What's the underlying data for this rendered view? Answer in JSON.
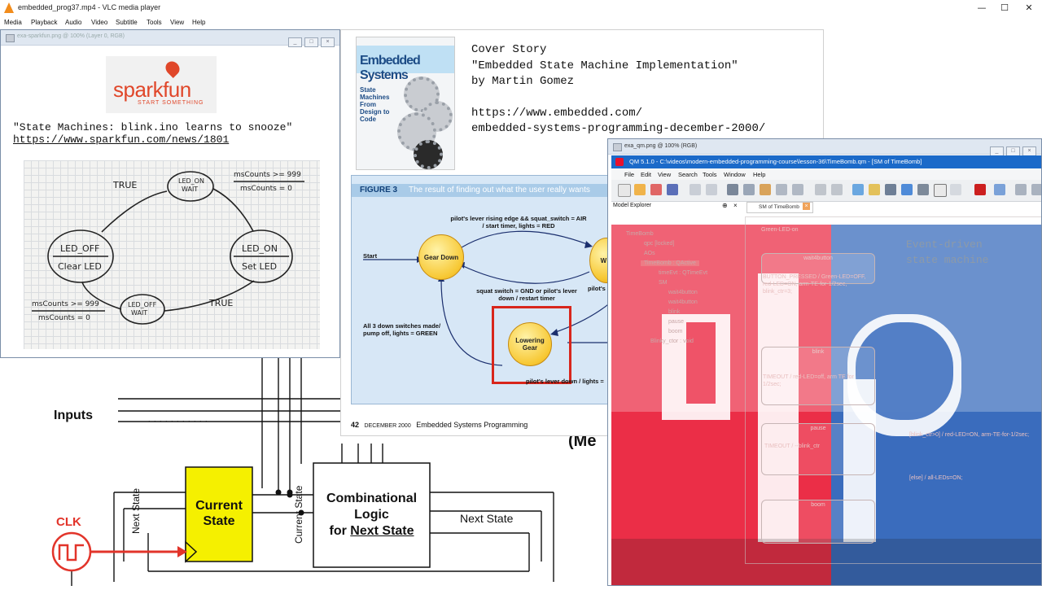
{
  "vlc": {
    "title": "embedded_prog37.mp4 - VLC media player",
    "menu": [
      "Media",
      "Playback",
      "Audio",
      "Video",
      "Subtitle",
      "Tools",
      "View",
      "Help"
    ],
    "controls": {
      "minimize": "—",
      "maximize": "☐",
      "close": "✕"
    }
  },
  "diagram": {
    "inputs": "Inputs",
    "dots": ". . . . . . . . . . .",
    "current_state_box": "Current State",
    "next_state_vertical": "Next State",
    "current_state_vertical": "Current State",
    "logic_line1": "Combinational",
    "logic_line2": "Logic",
    "logic_line3a": "for",
    "logic_line3b": "Next State",
    "next_state_out": "Next State",
    "clk": "CLK",
    "partial": "(Me"
  },
  "sparkfun_window": {
    "title": "exa-sparkfun.png @ 100% (Layer 0, RGB)",
    "logo_word": "sparkfun",
    "logo_sub": "START SOMETHING",
    "quote": "\"State Machines: blink.ino learns to snooze\"",
    "url": "https://www.sparkfun.com/news/1801",
    "sketch": {
      "true_top": "TRUE",
      "true_bottom": "TRUE",
      "led_on_wait": [
        "LED_ON",
        "WAIT"
      ],
      "led_off_wait": [
        "LED_OFF",
        "WAIT"
      ],
      "led_off": [
        "LED_OFF",
        "Clear LED"
      ],
      "led_on": [
        "LED_ON",
        "Set LED"
      ],
      "cond_top": [
        "msCounts >= 999",
        "msCounts = 0"
      ],
      "cond_bottom": [
        "msCounts >= 999",
        "msCounts = 0"
      ]
    }
  },
  "article": {
    "magazine_title": "Embedded Systems",
    "magazine_sub": "State Machines From Design to Code",
    "story_line1": "Cover Story",
    "story_line2": "\"Embedded State Machine Implementation\"",
    "story_line3": "by Martin Gomez",
    "story_url1": "https://www.embedded.com/",
    "story_url2": "embedded-systems-programming-december-2000/",
    "figure_label": "FIGURE 3",
    "figure_caption": "The result of finding out what the user really wants",
    "start": "Start",
    "gear_down": "Gear Down",
    "lowering_gear": "Lowering Gear",
    "partial_node": "W T",
    "edge_top": "pilot's lever rising edge && squat_switch = AIR / start timer, lights = RED",
    "edge_mid": "squat switch = GND or pilot's lever down / restart timer",
    "edge_left": "All 3 down switches made/ pump off, lights = GREEN",
    "edge_bottom": "pilot's lever down / lights =",
    "edge_right_partial": "pilot's l",
    "footer_page": "42",
    "footer_date": "DECEMBER 2000",
    "footer_pub": "Embedded Systems Programming"
  },
  "qm": {
    "outer_title": "exa_qm.png @ 100% (RGB)",
    "window_title": "QM 5.1.0 - C:\\videos\\modern-embedded-programming-course\\lesson-36\\TimeBomb.qm - [SM of TimeBomb]",
    "menu": [
      "File",
      "Edit",
      "View",
      "Search",
      "Tools",
      "Window",
      "Help"
    ],
    "explorer_label": "Model Explorer",
    "tab_label": "SM of TimeBomb",
    "tree": [
      "TimeBomb",
      "qpc [locked]",
      "AOs",
      "TimeBomb : QActive",
      "timeEvt : QTimeEvt",
      "SM",
      "wait4button",
      "wait4button",
      "blink",
      "pause",
      "boom",
      "Blinky_ctor : void"
    ],
    "event_driven": "Event-driven\nstate machine",
    "states": [
      "wait4button",
      "blink",
      "pause",
      "boom"
    ],
    "sm_texts": [
      "Green-LED-on",
      "BUTTON_PRESSED / Green-LED=OFF, red-LED=ON, arm-TE-for-1/2sec, blink_ctr=3;",
      "TIMEOUT / red-LED=off, arm TE for 1/2sec;",
      "TIMEOUT / --blink_ctr",
      "[blink_ctr>0] / red-LED=ON, arm-TE-for-1/2sec;",
      "[else] / all-LEDs=ON;"
    ],
    "colors": {
      "red": "#e8112d",
      "blue": "#1f58b4"
    }
  }
}
